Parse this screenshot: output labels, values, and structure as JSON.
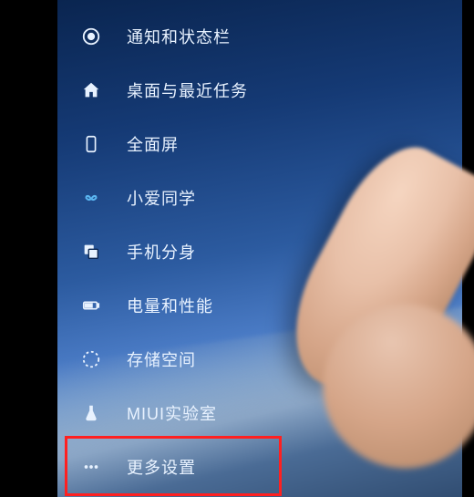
{
  "settings": {
    "items": [
      {
        "id": "notification",
        "label": "通知和状态栏"
      },
      {
        "id": "desktop",
        "label": "桌面与最近任务"
      },
      {
        "id": "fullscreen",
        "label": "全面屏"
      },
      {
        "id": "xiaoai",
        "label": "小爱同学"
      },
      {
        "id": "dualapp",
        "label": "手机分身"
      },
      {
        "id": "battery",
        "label": "电量和性能"
      },
      {
        "id": "storage",
        "label": "存储空间"
      },
      {
        "id": "miuilab",
        "label": "MIUI实验室"
      },
      {
        "id": "more",
        "label": "更多设置"
      }
    ]
  },
  "highlighted_item_index": 8
}
